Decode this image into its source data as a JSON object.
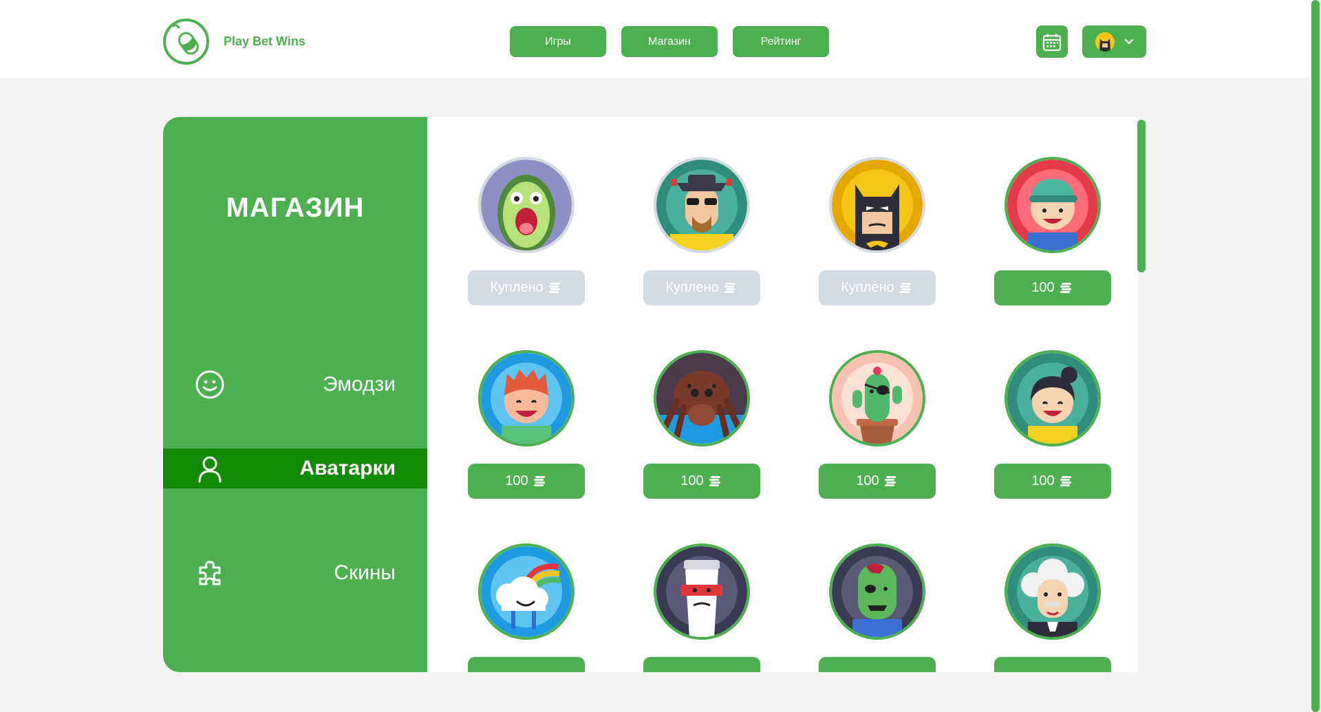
{
  "header": {
    "brand": "Play Bet Wins",
    "nav": [
      "Игры",
      "Магазин",
      "Рейтинг"
    ],
    "calendar_icon": "calendar-icon",
    "profile_avatar": "batman",
    "profile_chevron": "chevron-down-icon"
  },
  "sidebar": {
    "title": "МАГАЗИН",
    "items": [
      {
        "label": "Эмодзи",
        "icon": "smiley-icon",
        "active": false
      },
      {
        "label": "Аватарки",
        "icon": "user-icon",
        "active": true
      },
      {
        "label": "Скины",
        "icon": "puzzle-icon",
        "active": false
      }
    ]
  },
  "shop": {
    "items": [
      {
        "avatar": "avocado",
        "button": "Куплено",
        "owned": true
      },
      {
        "avatar": "heisenberg",
        "button": "Куплено",
        "owned": true
      },
      {
        "avatar": "batman",
        "button": "Куплено",
        "owned": true
      },
      {
        "avatar": "boy-cap",
        "button": "100",
        "owned": false
      },
      {
        "avatar": "redhead-boy",
        "button": "100",
        "owned": false
      },
      {
        "avatar": "spider",
        "button": "100",
        "owned": false
      },
      {
        "avatar": "pirate-cactus",
        "button": "100",
        "owned": false
      },
      {
        "avatar": "girl",
        "button": "100",
        "owned": false
      },
      {
        "avatar": "rainbow-cloud",
        "button": "",
        "owned": false
      },
      {
        "avatar": "coffee-cup",
        "button": "",
        "owned": false
      },
      {
        "avatar": "zombie",
        "button": "",
        "owned": false
      },
      {
        "avatar": "einstein",
        "button": "",
        "owned": false
      }
    ]
  },
  "colors": {
    "accent": "#4caf50",
    "active": "#138a04",
    "owned": "#d3dae1"
  }
}
